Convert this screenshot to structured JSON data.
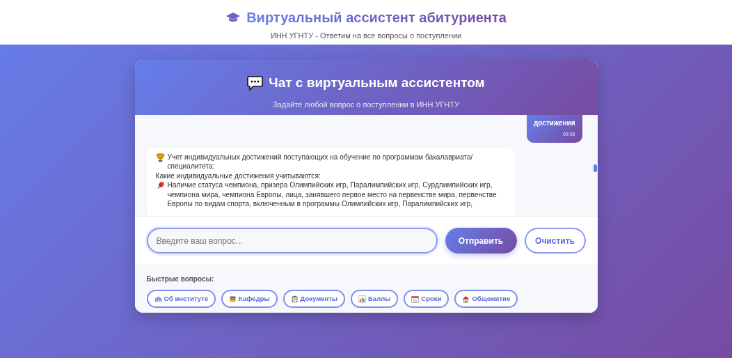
{
  "header": {
    "title": "Виртуальный ассистент абитуриента",
    "subtitle": "ИНН УГНТУ - Ответим на все вопросы о поступлении"
  },
  "chat": {
    "title": "Чат с виртуальным ассистентом",
    "subtitle": "Задайте любой вопрос о поступлении в ИНН УГНТУ"
  },
  "messages": [
    {
      "kind": "user",
      "text": "достижения",
      "time": "00:09"
    },
    {
      "kind": "bot",
      "paragraphs": [
        {
          "kind": "heading",
          "text": "Учет индивидуальных достижений поступающих на обучение по программам бакалавриата/специалитета:"
        },
        {
          "kind": "plain",
          "text": "Какие индивидуальные достижения учитываются:"
        },
        {
          "kind": "item",
          "text": "Наличие статуса чемпиона, призера Олимпийских игр, Паралимпийских игр, Сурдлимпийских игр, чемпиона мира, чемпиона Европы, лица, занявшего первое место на первенстве мира, первенстве Европы по видам спорта, включенным в программы Олимпийских игр, Паралимпийских игр,"
        }
      ]
    }
  ],
  "input": {
    "placeholder": "Введите ваш вопрос..."
  },
  "buttons": {
    "send": "Отправить",
    "clear": "Очистить"
  },
  "quick": {
    "label": "Быстрые вопросы:",
    "items": [
      "Об институте",
      "Кафедры",
      "Документы",
      "Баллы",
      "Сроки",
      "Общежитие"
    ]
  }
}
